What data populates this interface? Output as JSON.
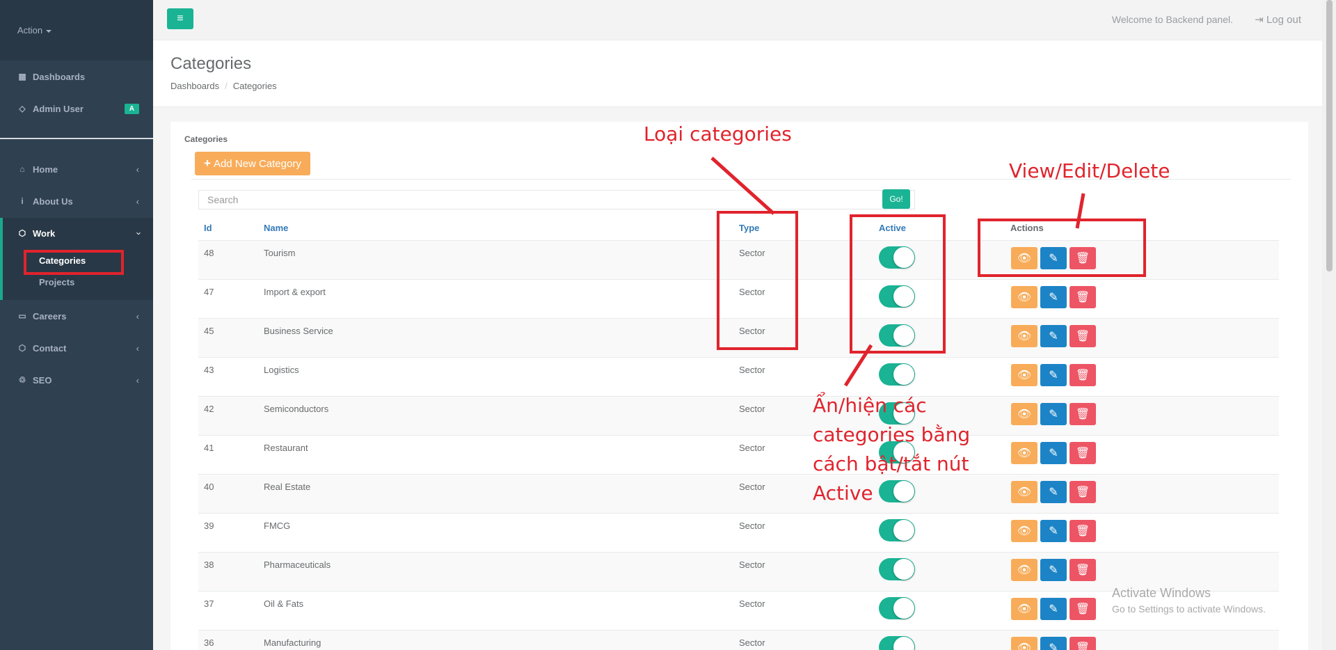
{
  "sidebar": {
    "action_menu": "Action",
    "items": [
      {
        "label": "Dashboards",
        "icon": "grid-icon"
      },
      {
        "label": "Admin User",
        "icon": "diamond-icon",
        "badge": "A"
      },
      {
        "label": "Home",
        "icon": "home-icon"
      },
      {
        "label": "About Us",
        "icon": "info-icon"
      },
      {
        "label": "Work",
        "icon": "cube-icon"
      },
      {
        "label": "Careers",
        "icon": "keyboard-icon"
      },
      {
        "label": "Contact",
        "icon": "cube-icon"
      },
      {
        "label": "SEO",
        "icon": "recycle-icon"
      }
    ],
    "work_sub": [
      "Categories",
      "Projects"
    ]
  },
  "topbar": {
    "welcome": "Welcome to Backend panel.",
    "logout": "Log out"
  },
  "header": {
    "title": "Categories",
    "breadcrumb": [
      "Dashboards",
      "Categories"
    ]
  },
  "panel": {
    "title": "Categories",
    "add_button": "Add New Category",
    "search_placeholder": "Search",
    "go_button": "Go!"
  },
  "table": {
    "columns": [
      "Id",
      "Name",
      "Type",
      "Active",
      "Actions"
    ],
    "rows": [
      {
        "id": "48",
        "name": "Tourism",
        "type": "Sector",
        "active": true
      },
      {
        "id": "47",
        "name": "Import & export",
        "type": "Sector",
        "active": true
      },
      {
        "id": "45",
        "name": "Business Service",
        "type": "Sector",
        "active": true
      },
      {
        "id": "43",
        "name": "Logistics",
        "type": "Sector",
        "active": true
      },
      {
        "id": "42",
        "name": "Semiconductors",
        "type": "Sector",
        "active": true
      },
      {
        "id": "41",
        "name": "Restaurant",
        "type": "Sector",
        "active": true
      },
      {
        "id": "40",
        "name": "Real Estate",
        "type": "Sector",
        "active": true
      },
      {
        "id": "39",
        "name": "FMCG",
        "type": "Sector",
        "active": true
      },
      {
        "id": "38",
        "name": "Pharmaceuticals",
        "type": "Sector",
        "active": true
      },
      {
        "id": "37",
        "name": "Oil & Fats",
        "type": "Sector",
        "active": true
      },
      {
        "id": "36",
        "name": "Manufacturing",
        "type": "Sector",
        "active": true
      }
    ]
  },
  "annotations": {
    "type_note": "Loại categories",
    "actions_note": "View/Edit/Delete",
    "active_note": [
      "Ẩn/hiện các",
      "categories bằng",
      "cách bật/tắt nút",
      "Active"
    ]
  },
  "watermark": {
    "title": "Activate Windows",
    "subtitle": "Go to Settings to activate Windows."
  },
  "colors": {
    "sidebar": "#2f4050",
    "accent": "#1ab394",
    "warning": "#f8ac59",
    "primary": "#1c84c6",
    "danger": "#ed5565",
    "annotation": "#e0242d"
  }
}
